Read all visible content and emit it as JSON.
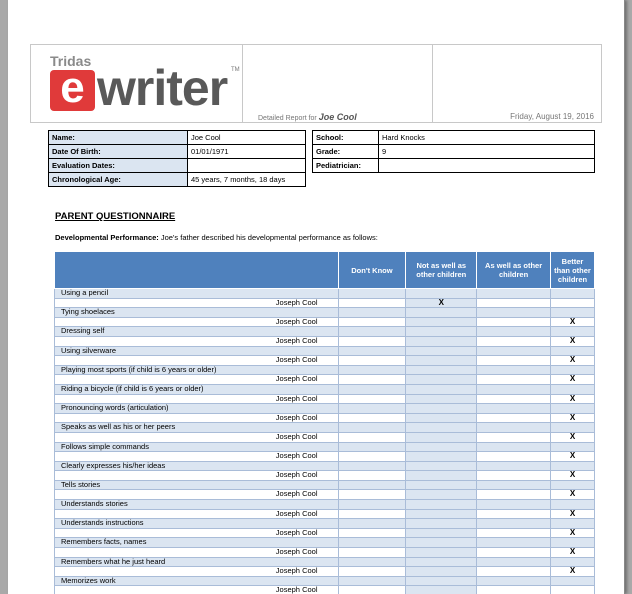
{
  "header": {
    "logo_tridas": "Tridas",
    "logo_e": "e",
    "logo_writer": "writer",
    "logo_tm": "TM",
    "report_label": "Detailed Report for",
    "report_name": "Joe Cool",
    "date": "Friday, August 19, 2016"
  },
  "info": {
    "name_label": "Name:",
    "name_value": "Joe Cool",
    "school_label": "School:",
    "school_value": "Hard Knocks",
    "dob_label": "Date Of Birth:",
    "dob_value": "01/01/1971",
    "grade_label": "Grade:",
    "grade_value": "9",
    "eval_label": "Evaluation Dates:",
    "eval_value": "",
    "pediatrician_label": "Pediatrician:",
    "pediatrician_value": "",
    "age_label": "Chronological Age:",
    "age_value": "45 years, 7 months,  18 days"
  },
  "section_title": "PARENT QUESTIONNAIRE",
  "devperf": {
    "label": "Developmental Performance:",
    "text": " Joe's father described his developmental performance as follows:"
  },
  "columns": [
    "Don't Know",
    "Not as well as other children",
    "As well as other children",
    "Better than other children"
  ],
  "items": [
    {
      "q": "Using a pencil",
      "who": "Joseph Cool",
      "marks": [
        "",
        "X",
        "",
        ""
      ]
    },
    {
      "q": "Tying shoelaces",
      "who": "Joseph Cool",
      "marks": [
        "",
        "",
        "",
        "X"
      ]
    },
    {
      "q": "Dressing self",
      "who": "Joseph Cool",
      "marks": [
        "",
        "",
        "",
        "X"
      ]
    },
    {
      "q": "Using silverware",
      "who": "Joseph Cool",
      "marks": [
        "",
        "",
        "",
        "X"
      ]
    },
    {
      "q": "Playing most sports (if child is 6 years or older)",
      "who": "Joseph Cool",
      "marks": [
        "",
        "",
        "",
        "X"
      ]
    },
    {
      "q": "Riding a bicycle (if child is 6 years or older)",
      "who": "Joseph Cool",
      "marks": [
        "",
        "",
        "",
        "X"
      ]
    },
    {
      "q": "Pronouncing words (articulation)",
      "who": "Joseph Cool",
      "marks": [
        "",
        "",
        "",
        "X"
      ]
    },
    {
      "q": "Speaks as well as his or her peers",
      "who": "Joseph Cool",
      "marks": [
        "",
        "",
        "",
        "X"
      ]
    },
    {
      "q": "Follows simple commands",
      "who": "Joseph Cool",
      "marks": [
        "",
        "",
        "",
        "X"
      ]
    },
    {
      "q": "Clearly expresses his/her ideas",
      "who": "Joseph Cool",
      "marks": [
        "",
        "",
        "",
        "X"
      ]
    },
    {
      "q": "Tells stories",
      "who": "Joseph Cool",
      "marks": [
        "",
        "",
        "",
        "X"
      ]
    },
    {
      "q": "Understands stories",
      "who": "Joseph Cool",
      "marks": [
        "",
        "",
        "",
        "X"
      ]
    },
    {
      "q": "Understands instructions",
      "who": "Joseph Cool",
      "marks": [
        "",
        "",
        "",
        "X"
      ]
    },
    {
      "q": "Remembers facts, names",
      "who": "Joseph Cool",
      "marks": [
        "",
        "",
        "",
        "X"
      ]
    },
    {
      "q": "Remembers what he just heard",
      "who": "Joseph Cool",
      "marks": [
        "",
        "",
        "",
        "X"
      ]
    },
    {
      "q": "Memorizes work",
      "who": "Joseph Cool",
      "marks": [
        "",
        "",
        "",
        ""
      ]
    }
  ]
}
